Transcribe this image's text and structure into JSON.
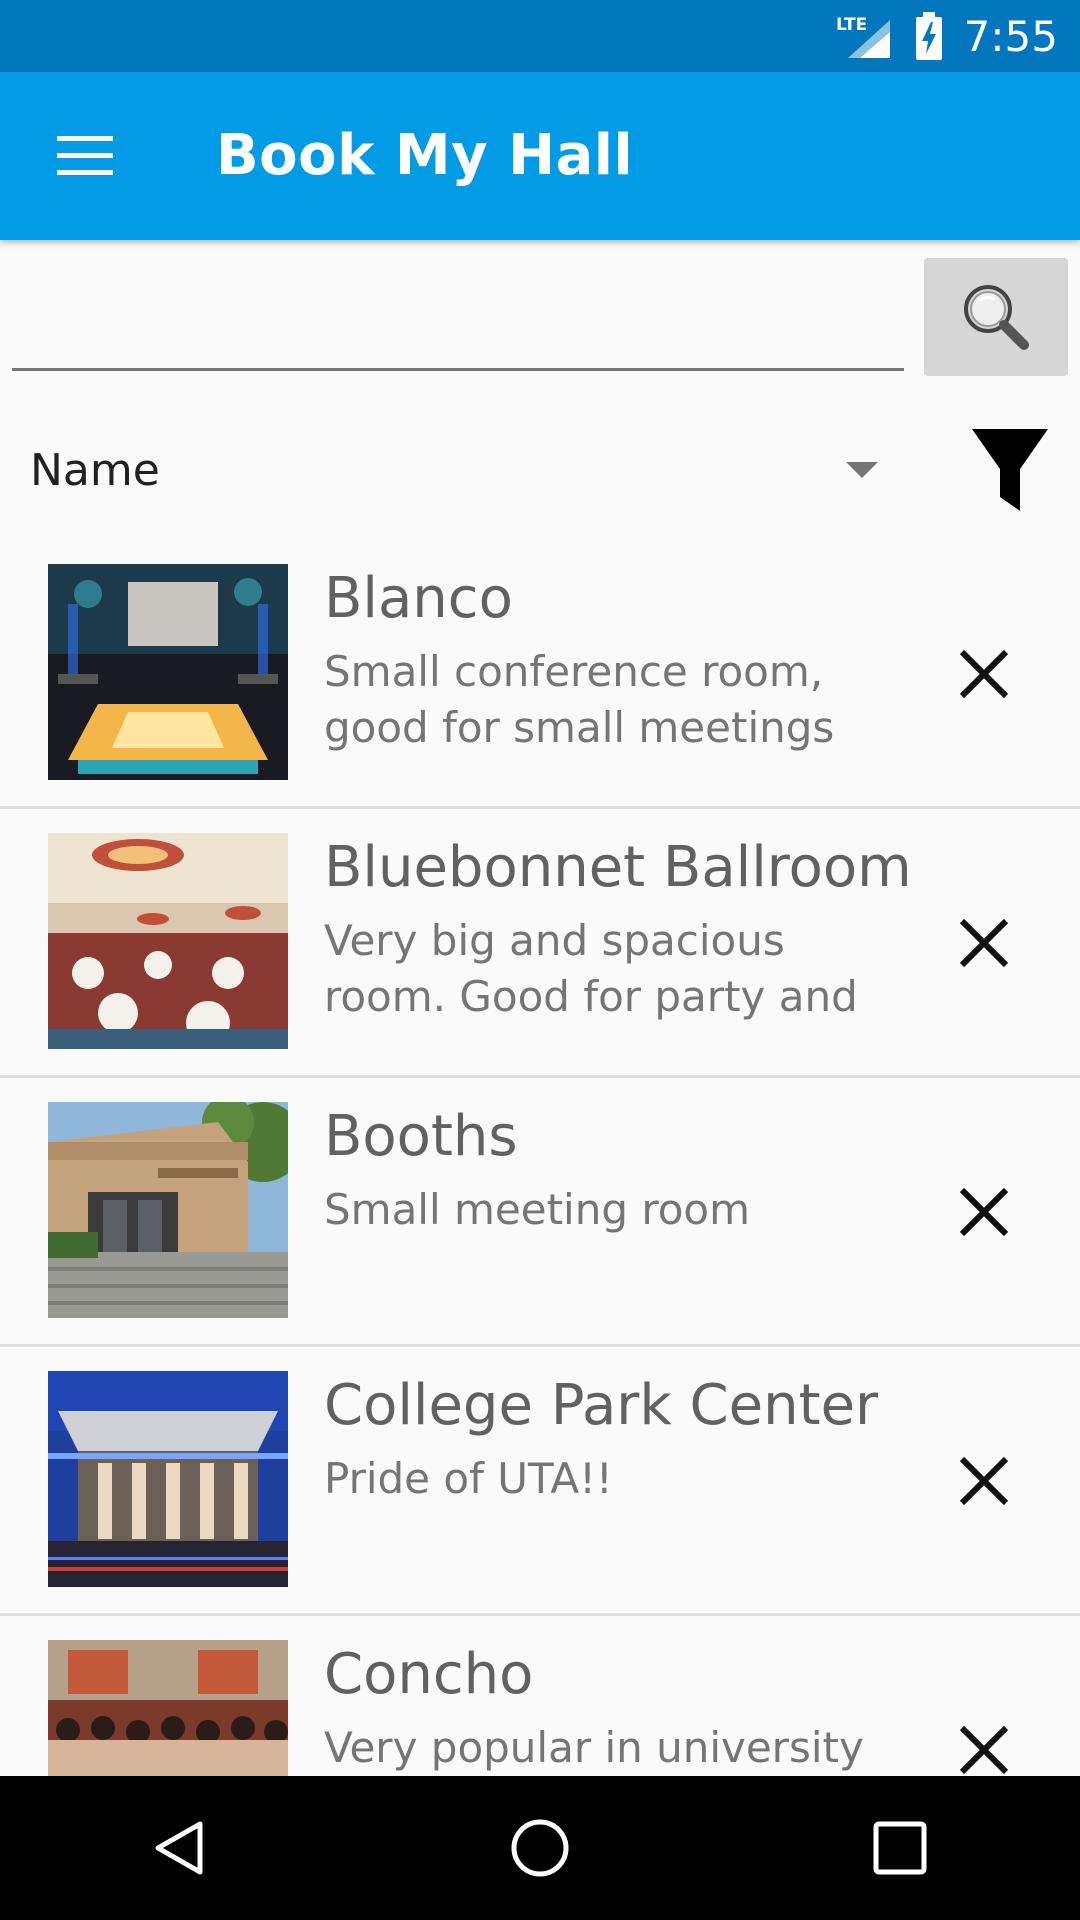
{
  "status_bar": {
    "network": "LTE",
    "time": "7:55"
  },
  "app_bar": {
    "title": "Book My Hall",
    "menu_icon": "hamburger-menu-icon"
  },
  "search": {
    "value": "",
    "placeholder": "",
    "button_icon": "search-icon"
  },
  "sort": {
    "selected": "Name",
    "filter_icon": "filter-icon"
  },
  "halls": [
    {
      "name": "Blanco",
      "description": "Small conference room, good for small meetings",
      "thumb": "conference-room-photo"
    },
    {
      "name": "Bluebonnet Ballroom",
      "description": "Very big and spacious room. Good for party and",
      "thumb": "ballroom-photo"
    },
    {
      "name": "Booths",
      "description": "Small meeting room",
      "thumb": "building-entrance-photo"
    },
    {
      "name": "College Park Center",
      "description": "Pride of UTA!!",
      "thumb": "arena-night-photo"
    },
    {
      "name": "Concho",
      "description": "Very popular in university",
      "thumb": "audience-photo"
    }
  ],
  "nav_bar": {
    "back_icon": "back-icon",
    "home_icon": "home-icon",
    "recents_icon": "recents-icon"
  }
}
